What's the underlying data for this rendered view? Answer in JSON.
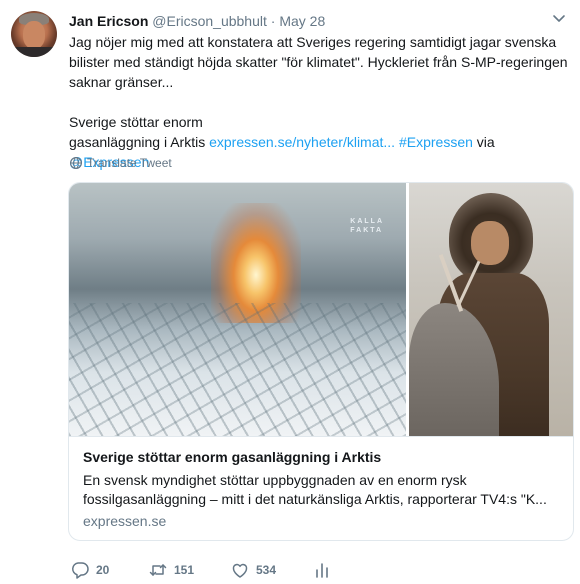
{
  "tweet": {
    "author_name": "Jan Ericson",
    "handle": "@Ericson_ubbhult",
    "separator": "·",
    "date": "May 28",
    "text_line1": "Jag nöjer mig med att konstatera att Sveriges regering samtidigt jagar svenska bilister med ständigt höjda skatter \"för klimatet\". Hyckleriet från S-MP-regeringen saknar gränser...",
    "text_line2a": "Sverige stöttar enorm",
    "text_line2b": "gasanläggning i Arktis ",
    "link_url": "expressen.se/nyheter/klimat...",
    "hashtag": "#Expressen",
    "via": "via",
    "mention": "@Expressen",
    "translate_label": "Translate Tweet"
  },
  "card": {
    "watermark_line1": "KALLA",
    "watermark_line2": "FAKTA",
    "title": "Sverige stöttar enorm gasanläggning i Arktis",
    "description": "En svensk myndighet stöttar uppbyggnaden av en enorm rysk fossilgasanläggning – mitt i det naturkänsliga Arktis, rapporterar TV4:s \"K...",
    "domain": "expressen.se"
  },
  "actions": {
    "reply_count": "20",
    "retweet_count": "151",
    "like_count": "534"
  },
  "icons": {
    "menu": "chevron-down-icon",
    "translate": "globe-icon",
    "reply": "reply-icon",
    "retweet": "retweet-icon",
    "like": "heart-icon",
    "stats": "analytics-icon"
  },
  "colors": {
    "link": "#1da1f2",
    "secondary_text": "#657786",
    "border": "#e1e8ed"
  }
}
